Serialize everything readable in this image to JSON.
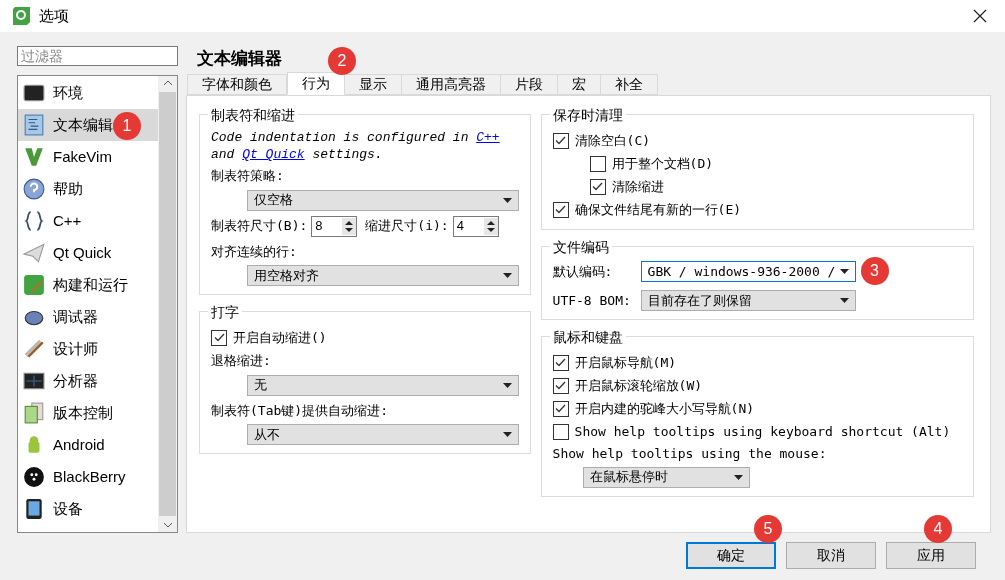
{
  "window": {
    "title": "选项"
  },
  "filter": {
    "placeholder": "过滤器"
  },
  "sidebar": {
    "items": [
      {
        "label": "环境",
        "selected": false
      },
      {
        "label": "文本编辑",
        "selected": true
      },
      {
        "label": "FakeVim",
        "selected": false
      },
      {
        "label": "帮助",
        "selected": false
      },
      {
        "label": "C++",
        "selected": false
      },
      {
        "label": "Qt Quick",
        "selected": false
      },
      {
        "label": "构建和运行",
        "selected": false
      },
      {
        "label": "调试器",
        "selected": false
      },
      {
        "label": "设计师",
        "selected": false
      },
      {
        "label": "分析器",
        "selected": false
      },
      {
        "label": "版本控制",
        "selected": false
      },
      {
        "label": "Android",
        "selected": false
      },
      {
        "label": "BlackBerry",
        "selected": false
      },
      {
        "label": "设备",
        "selected": false
      }
    ]
  },
  "page_title": "文本编辑器",
  "tabs": [
    {
      "label": "字体和颜色",
      "selected": false
    },
    {
      "label": "行为",
      "selected": true
    },
    {
      "label": "显示",
      "selected": false
    },
    {
      "label": "通用高亮器",
      "selected": false
    },
    {
      "label": "片段",
      "selected": false
    },
    {
      "label": "宏",
      "selected": false
    },
    {
      "label": "补全",
      "selected": false
    }
  ],
  "tabs_indent": {
    "title": "制表符和缩进",
    "note_before": "Code indentation is configured in ",
    "link_1": "C++",
    "note_middle": "and ",
    "link_2": "Qt Quick",
    "note_after": " settings.",
    "policy_label": "制表符策略:",
    "policy_value": "仅空格",
    "tab_size_label": "制表符尺寸(B):",
    "tab_size": "8",
    "indent_size_label": "缩进尺寸(i):",
    "indent_size": "4",
    "align_label": "对齐连续的行:",
    "align_value": "用空格对齐"
  },
  "typing": {
    "title": "打字",
    "auto_indent": {
      "label": "开启自动缩进()",
      "checked": true
    },
    "backspace_label": "退格缩进:",
    "backspace_value": "无",
    "tab_key_label": "制表符(Tab键)提供自动缩进:",
    "tab_key_value": "从不"
  },
  "cleanup": {
    "title": "保存时清理",
    "items": [
      {
        "label": "清除空白(C)",
        "checked": true,
        "children": [
          {
            "label": "用于整个文档(D)",
            "checked": false
          },
          {
            "label": "清除缩进",
            "checked": true
          }
        ]
      },
      {
        "label": "确保文件结尾有新的一行(E)",
        "checked": true
      }
    ]
  },
  "encoding": {
    "title": "文件编码",
    "default_label": "默认编码:",
    "default_value": "GBK / windows-936-2000 /",
    "bom_label": "UTF-8 BOM:",
    "bom_value": "目前存在了则保留"
  },
  "mouse_keyboard": {
    "title": "鼠标和键盘",
    "items": [
      {
        "label": "开启鼠标导航(M)",
        "checked": true
      },
      {
        "label": "开启鼠标滚轮缩放(W)",
        "checked": true
      },
      {
        "label": "开启内建的驼峰大小写导航(N)",
        "checked": true
      },
      {
        "label": "Show help tooltips using keyboard shortcut (Alt)",
        "checked": false
      }
    ],
    "tooltip_label": "Show help tooltips using the mouse:",
    "tooltip_value": "在鼠标悬停时"
  },
  "buttons": [
    {
      "label": "确定",
      "selected": true
    },
    {
      "label": "取消",
      "selected": false
    },
    {
      "label": "应用",
      "selected": false
    }
  ],
  "annotations": {
    "sidebar": "1",
    "tab": "2",
    "encoding": "3",
    "apply": "4",
    "ok": "5"
  }
}
